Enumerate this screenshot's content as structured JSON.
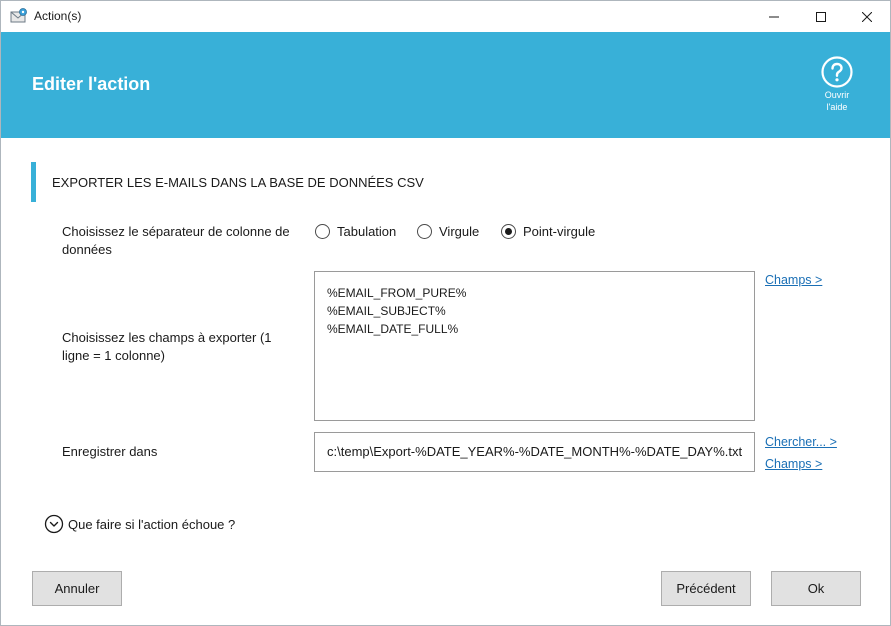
{
  "window": {
    "title": "Action(s)",
    "icon": "envelope-gear-icon"
  },
  "header": {
    "title": "Editer l'action",
    "help_label_line1": "Ouvrir",
    "help_label_line2": "l'aide",
    "help_icon": "question-circle-icon",
    "color": "#38b0d8"
  },
  "section": {
    "title": "EXPORTER LES E-MAILS DANS LA BASE DE DONNÉES CSV"
  },
  "separator": {
    "label": "Choisissez le séparateur de colonne de données",
    "options": [
      {
        "label": "Tabulation",
        "selected": false
      },
      {
        "label": "Virgule",
        "selected": false
      },
      {
        "label": "Point-virgule",
        "selected": true
      }
    ]
  },
  "fields": {
    "label": "Choisissez les champs à exporter (1 ligne = 1 colonne)",
    "lines": [
      "%EMAIL_FROM_PURE%",
      "%EMAIL_SUBJECT%",
      "%EMAIL_DATE_FULL%"
    ],
    "link": "Champs >"
  },
  "save": {
    "label": "Enregistrer dans",
    "value": "c:\\temp\\Export-%DATE_YEAR%-%DATE_MONTH%-%DATE_DAY%.txt",
    "browse_link": "Chercher... >",
    "fields_link": "Champs >"
  },
  "failure": {
    "label": "Que faire si l'action échoue ?",
    "icon": "chevron-down-circle-icon"
  },
  "buttons": {
    "cancel": "Annuler",
    "previous": "Précédent",
    "ok": "Ok"
  }
}
